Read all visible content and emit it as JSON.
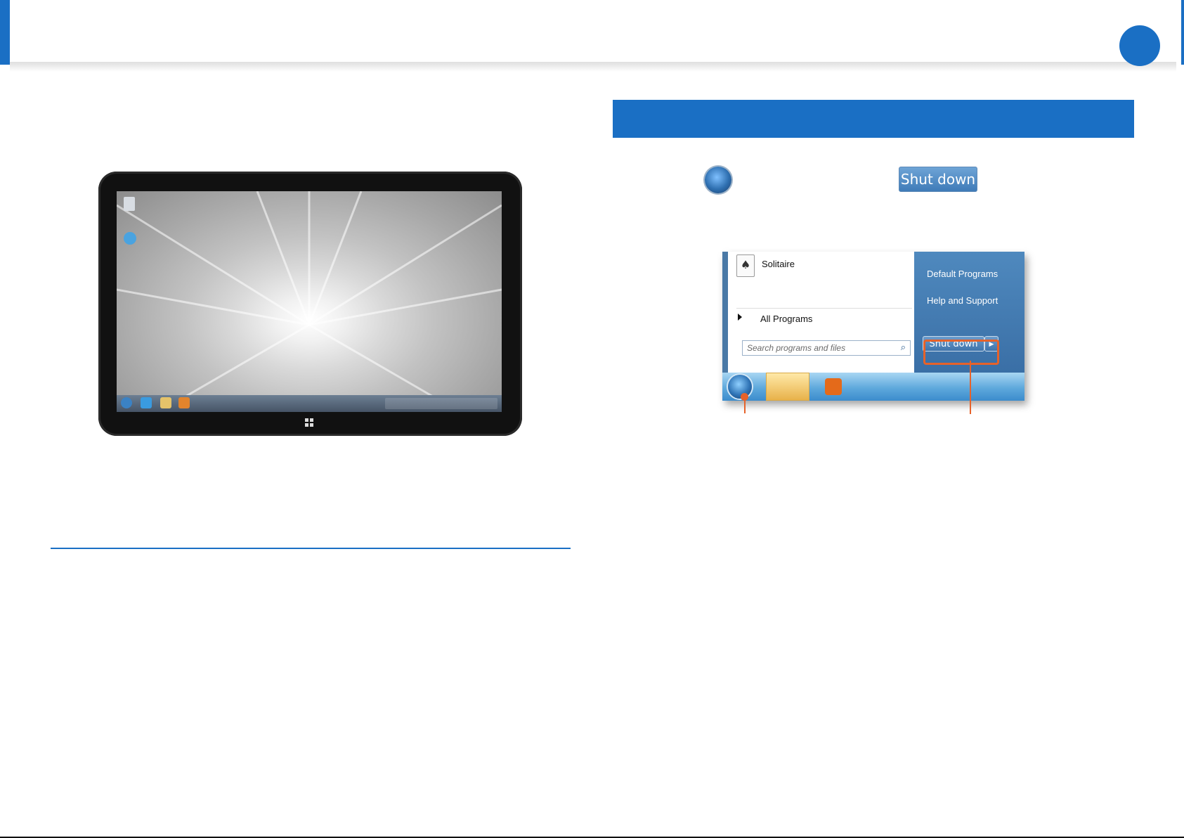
{
  "colors": {
    "accent": "#1a6fc4",
    "highlight": "#e6622a"
  },
  "inline_step": {
    "shutdown_button_label": "Shut down"
  },
  "start_menu": {
    "pinned_program": "Solitaire",
    "all_programs": "All Programs",
    "search_placeholder": "Search programs and files",
    "right_items": [
      "Default Programs",
      "Help and Support"
    ],
    "shutdown_label": "Shut down",
    "icons": [
      "windows-orb-icon",
      "explorer-icon",
      "media-player-icon",
      "search-icon",
      "solitaire-icon"
    ]
  }
}
